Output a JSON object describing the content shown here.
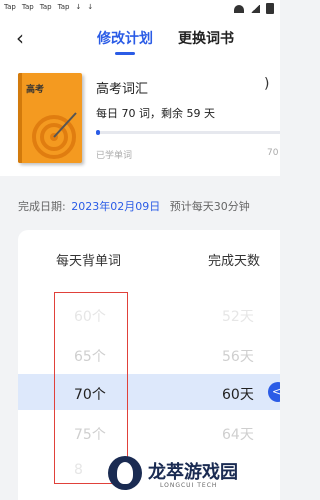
{
  "status_bar": {
    "apps": [
      "Tap",
      "Tap",
      "Tap",
      "Tap"
    ]
  },
  "header": {
    "back_icon": "chevron-left-icon",
    "tabs": [
      "修改计划",
      "更换词书"
    ],
    "active_tab": 0
  },
  "book": {
    "cover_label": "高考",
    "cover_color": "#f49a20",
    "name": "高考词汇",
    "plan_text": "每日 70 词，剩余 59 天",
    "progress_fraction": 0.02,
    "learned_label": "已学单词",
    "learned_count": "70"
  },
  "finish": {
    "label": "完成日期:",
    "date": "2023年02月09日",
    "estimate": "预计每天30分钟"
  },
  "picker": {
    "col_words": "每天背单词",
    "col_days": "完成天数",
    "rows": [
      {
        "words": "60个",
        "days": "52天"
      },
      {
        "words": "65个",
        "days": "56天"
      },
      {
        "words": "70个",
        "days": "60天"
      },
      {
        "words": "75个",
        "days": "64天"
      },
      {
        "words": "8",
        "days": ""
      }
    ],
    "selected_index": 2,
    "selected_badge": "<"
  },
  "watermark": {
    "name": "龙萃游戏园",
    "sub": "LONGCUI TECH"
  },
  "colors": {
    "accent": "#2b5ce6",
    "highlight": "#dde8fb",
    "annotation": "#e0413a"
  }
}
